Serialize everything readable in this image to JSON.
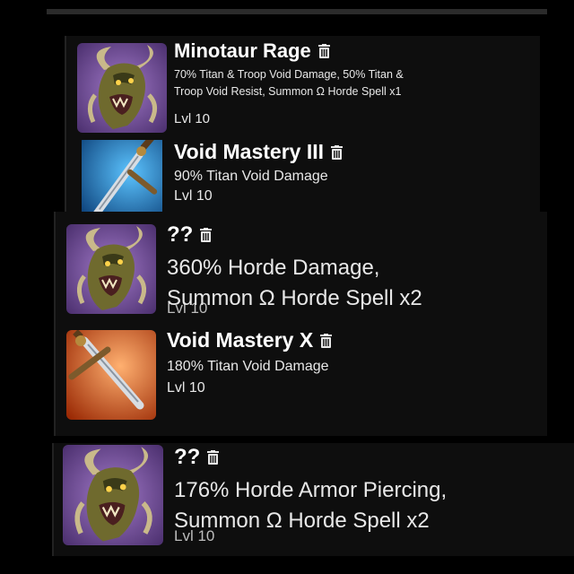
{
  "skills": [
    {
      "title": "Minotaur Rage",
      "desc_line1": "70% Titan & Troop Void Damage, 50% Titan &",
      "desc_line2": "Troop Void Resist, Summon Ω Horde Spell x1",
      "level": "Lvl 10",
      "icon": "minotaur-icon"
    },
    {
      "title": "Void Mastery III",
      "desc_line1": "90% Titan Void Damage",
      "level": "Lvl 10",
      "icon": "blue-sword-icon"
    },
    {
      "title": "??",
      "desc_line1": "360% Horde Damage,",
      "desc_line2": "Summon Ω Horde Spell x2",
      "level": "Lvl 10",
      "icon": "minotaur-icon"
    },
    {
      "title": "Void Mastery X",
      "desc_line1": "180% Titan Void Damage",
      "level": "Lvl 10",
      "icon": "orange-sword-icon"
    },
    {
      "title": "??",
      "desc_line1": "176% Horde Armor Piercing,",
      "desc_line2": "Summon Ω Horde Spell x2",
      "level": "Lvl 10",
      "icon": "minotaur-icon"
    }
  ],
  "colors": {
    "panel_bg": "#0e0e0e",
    "minotaur_bg": "#7a52a8",
    "blue_sword_bg": "#1f7fc4",
    "orange_sword_bg": "#d85a1e"
  }
}
